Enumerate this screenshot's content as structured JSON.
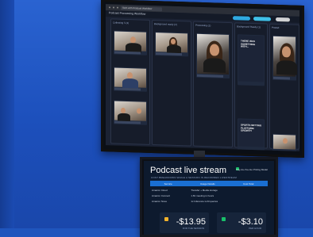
{
  "browser": {
    "tab_title": "Tech with Podcast Workflow"
  },
  "app": {
    "title": "Podcast Processing Workflow"
  },
  "board": {
    "columns": [
      {
        "title": "Collecting 5 (3)"
      },
      {
        "title": "Background ready (2)"
      },
      {
        "title": "Processing (1)"
      },
      {
        "title": "Background Ready (1)"
      },
      {
        "title": "Posted"
      }
    ],
    "poster_text": "THERE WAS SOMETHING WITH...",
    "poster2_text": "SPORTS SETTING PLATFORM GROWTH"
  },
  "tv": {
    "brand": "SAMSUNG"
  },
  "monitor": {
    "title": "Podcast live stream",
    "subtitle": "COST BREAKDOWN WHILE A SESSION IS RECORDED LIVESTREAM",
    "badge": "Pay-As-You-Go Pricing Model",
    "headers": [
      "Service",
      "Usage Details",
      "Cost Total"
    ],
    "rows": [
      [
        "Amazon Cloud",
        "Transfer + Media storage",
        ""
      ],
      [
        "Amazon Connect",
        "1.81 meeting in hours",
        ""
      ],
      [
        "Amazon Nova",
        "1x Inference LLM queries",
        ""
      ]
    ],
    "tiles": [
      {
        "value": "-$13.95",
        "label": "FOR THE SESSION"
      },
      {
        "value": "-$3.10",
        "label": "PER HOUR"
      }
    ]
  }
}
